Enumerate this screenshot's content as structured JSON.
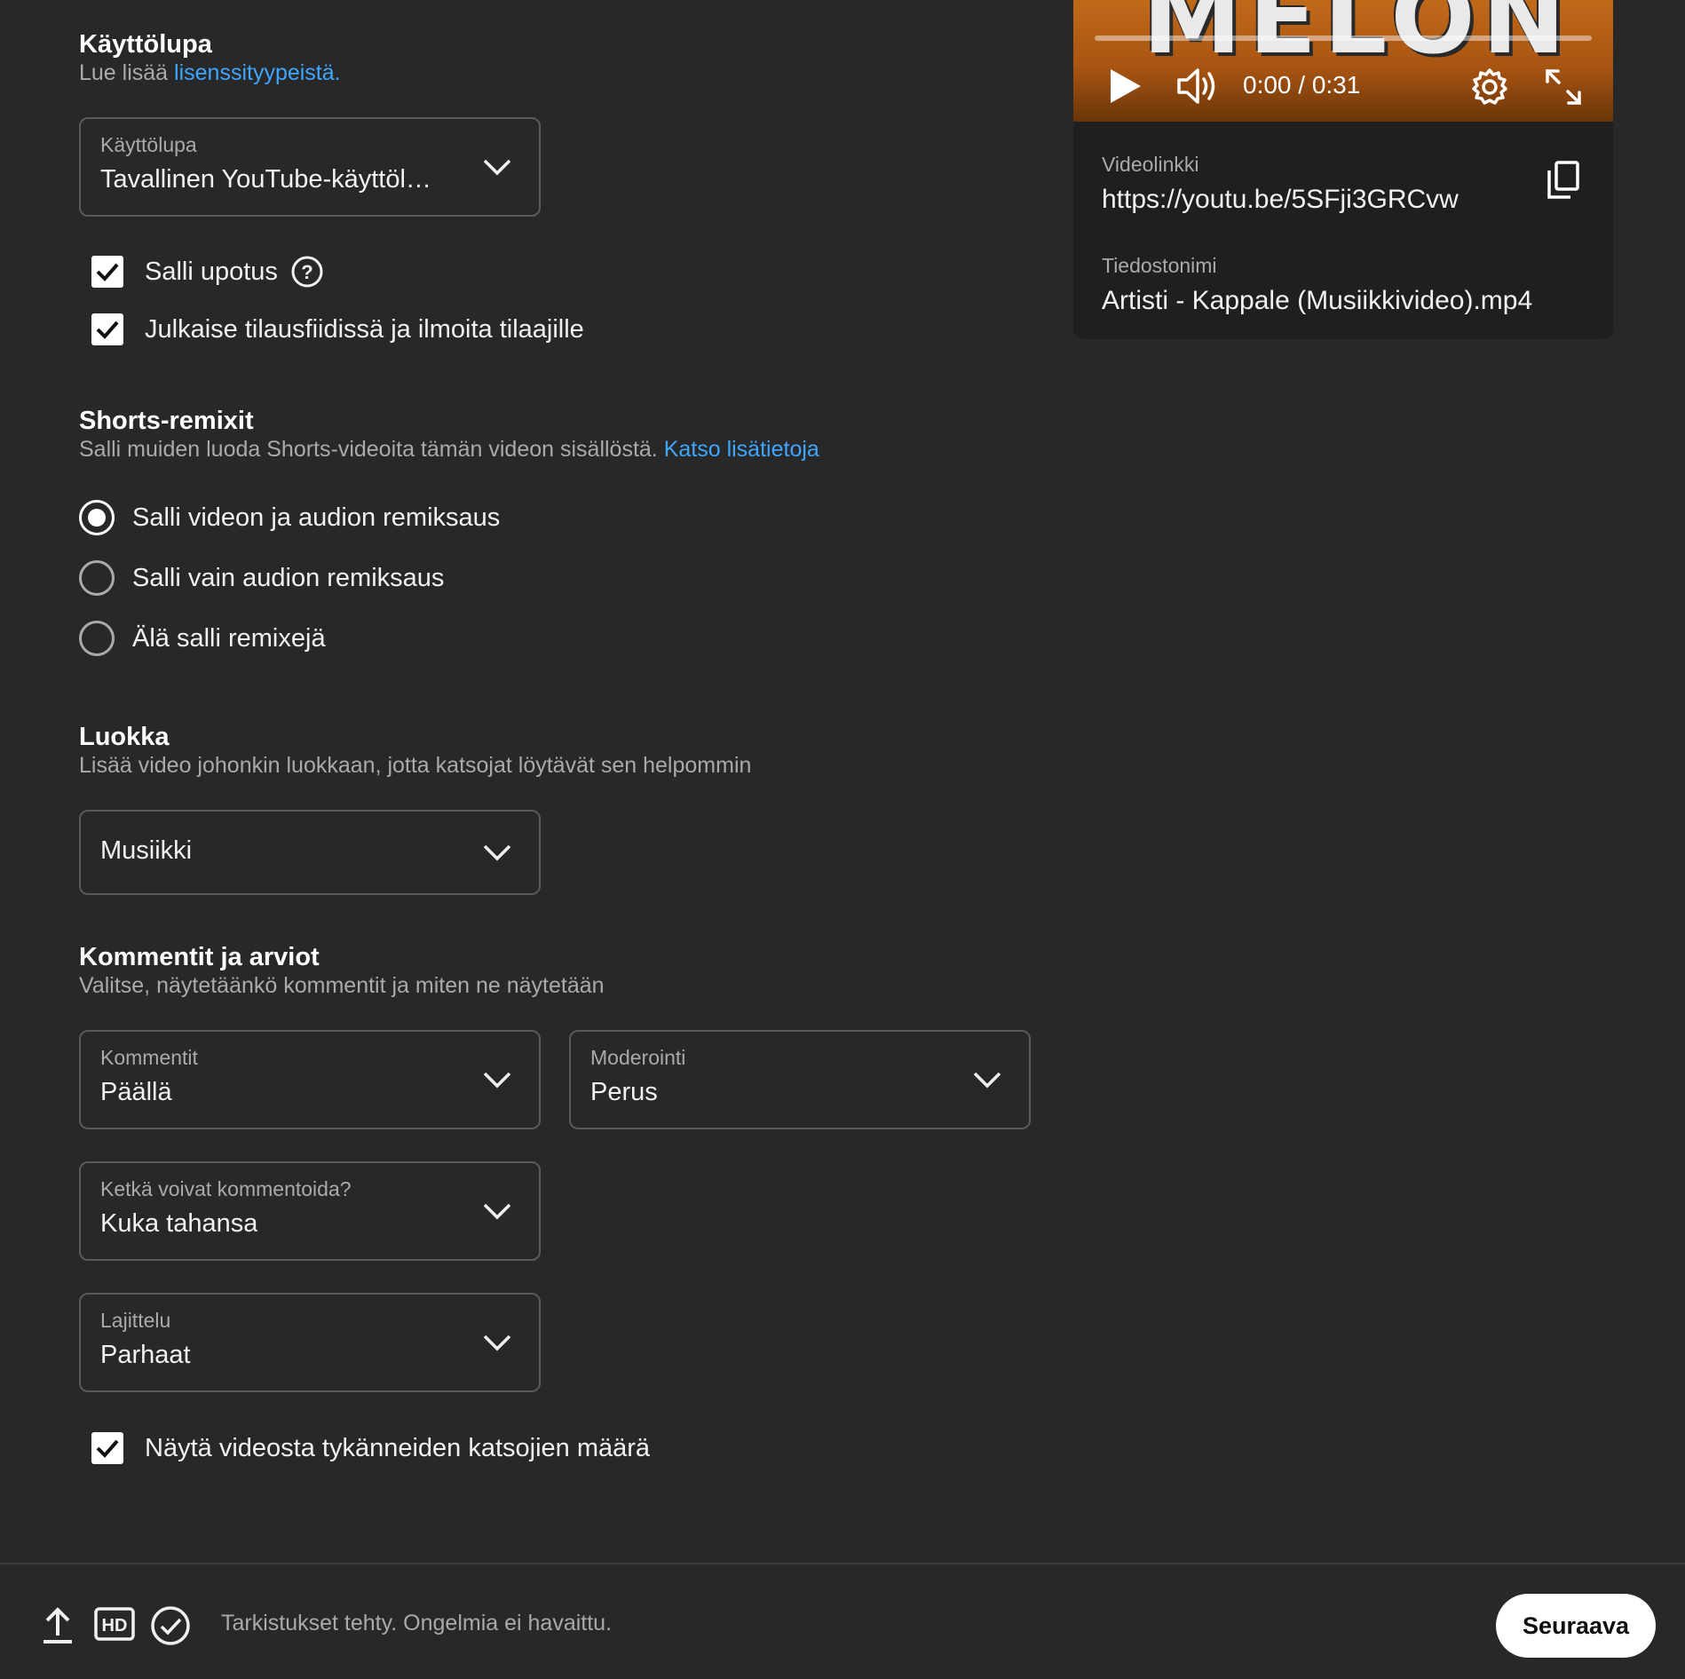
{
  "license": {
    "title": "Käyttölupa",
    "desc_prefix": "Lue lisää",
    "desc_link": "lisenssityypeistä.",
    "dropdown_label": "Käyttölupa",
    "dropdown_value": "Tavallinen YouTube-käyttöl…",
    "allow_embedding_label": "Salli upotus",
    "allow_embedding_checked": true,
    "publish_feed_label": "Julkaise tilausfiidissä ja ilmoita tilaajille",
    "publish_feed_checked": true
  },
  "shorts": {
    "title": "Shorts-remixit",
    "desc": "Salli muiden luoda Shorts-videoita tämän videon sisällöstä.",
    "desc_link": "Katso lisätietoja",
    "options": [
      {
        "label": "Salli videon ja audion remiksaus",
        "checked": true
      },
      {
        "label": "Salli vain audion remiksaus",
        "checked": false
      },
      {
        "label": "Älä salli remixejä",
        "checked": false
      }
    ]
  },
  "category": {
    "title": "Luokka",
    "desc": "Lisää video johonkin luokkaan, jotta katsojat löytävät sen helpommin",
    "value": "Musiikki"
  },
  "comments": {
    "title": "Kommentit ja arviot",
    "desc": "Valitse, näytetäänkö kommentit ja miten ne näytetään",
    "comments_label": "Kommentit",
    "comments_value": "Päällä",
    "moderation_label": "Moderointi",
    "moderation_value": "Perus",
    "who_label": "Ketkä voivat kommentoida?",
    "who_value": "Kuka tahansa",
    "sort_label": "Lajittelu",
    "sort_value": "Parhaat",
    "show_likes_label": "Näytä videosta tykänneiden katsojien määrä",
    "show_likes_checked": true
  },
  "video": {
    "thumbnail_text": "MELON",
    "time": "0:00 / 0:31",
    "progress": 0,
    "link_label": "Videolinkki",
    "link_url": "https://youtu.be/5SFji3GRCvw",
    "filename_label": "Tiedostonimi",
    "filename": "Artisti - Kappale (Musiikkivideo).mp4"
  },
  "footer": {
    "status": "Tarkistukset tehty. Ongelmia ei havaittu.",
    "next_label": "Seuraava",
    "hd_badge": "HD"
  },
  "colors": {
    "background": "#282828",
    "link": "#3ea6ff",
    "panel": "#1f1f1f",
    "thumbnail": "#c1691a"
  },
  "icons": [
    "chevron-down-icon",
    "help-icon",
    "play-icon",
    "volume-icon",
    "settings-icon",
    "fullscreen-icon",
    "copy-icon",
    "upload-icon",
    "hd-icon",
    "check-circle-icon"
  ]
}
